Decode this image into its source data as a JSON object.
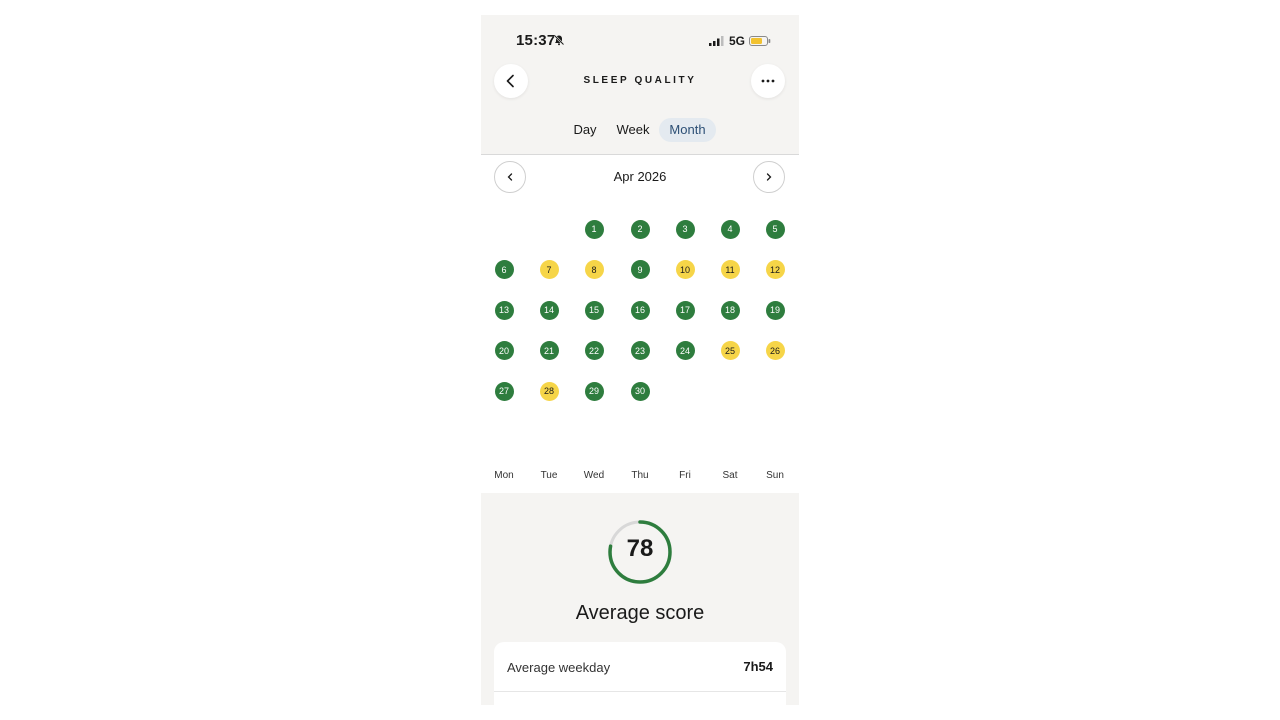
{
  "status_bar": {
    "time": "15:37",
    "network": "5G",
    "battery_color": "#f2c230"
  },
  "header": {
    "title": "SLEEP QUALITY",
    "back_icon": "chevron-left-icon",
    "more_icon": "more-horizontal-icon"
  },
  "tabs": [
    {
      "label": "Day",
      "active": false
    },
    {
      "label": "Week",
      "active": false
    },
    {
      "label": "Month",
      "active": true
    }
  ],
  "calendar": {
    "month_label": "Apr 2026",
    "prev_icon": "chevron-left-icon",
    "next_icon": "chevron-right-icon",
    "first_weekday_index": 2,
    "days": [
      {
        "day": "1",
        "quality": "good"
      },
      {
        "day": "2",
        "quality": "good"
      },
      {
        "day": "3",
        "quality": "good"
      },
      {
        "day": "4",
        "quality": "good"
      },
      {
        "day": "5",
        "quality": "good"
      },
      {
        "day": "6",
        "quality": "good"
      },
      {
        "day": "7",
        "quality": "fair"
      },
      {
        "day": "8",
        "quality": "fair"
      },
      {
        "day": "9",
        "quality": "good"
      },
      {
        "day": "10",
        "quality": "fair"
      },
      {
        "day": "11",
        "quality": "fair"
      },
      {
        "day": "12",
        "quality": "fair"
      },
      {
        "day": "13",
        "quality": "good"
      },
      {
        "day": "14",
        "quality": "good"
      },
      {
        "day": "15",
        "quality": "good"
      },
      {
        "day": "16",
        "quality": "good"
      },
      {
        "day": "17",
        "quality": "good"
      },
      {
        "day": "18",
        "quality": "good"
      },
      {
        "day": "19",
        "quality": "good"
      },
      {
        "day": "20",
        "quality": "good"
      },
      {
        "day": "21",
        "quality": "good"
      },
      {
        "day": "22",
        "quality": "good"
      },
      {
        "day": "23",
        "quality": "good"
      },
      {
        "day": "24",
        "quality": "good"
      },
      {
        "day": "25",
        "quality": "fair"
      },
      {
        "day": "26",
        "quality": "fair"
      },
      {
        "day": "27",
        "quality": "good"
      },
      {
        "day": "28",
        "quality": "fair"
      },
      {
        "day": "29",
        "quality": "good"
      },
      {
        "day": "30",
        "quality": "good"
      }
    ],
    "weekdays": [
      "Mon",
      "Tue",
      "Wed",
      "Thu",
      "Fri",
      "Sat",
      "Sun"
    ],
    "colors": {
      "good": "#2e7d3e",
      "fair": "#f6d548"
    }
  },
  "summary": {
    "score": "78",
    "score_fraction": 0.78,
    "score_color": "#2e7d3e",
    "label": "Average score",
    "rows": [
      {
        "label": "Average weekday",
        "value": "7h54"
      }
    ]
  }
}
